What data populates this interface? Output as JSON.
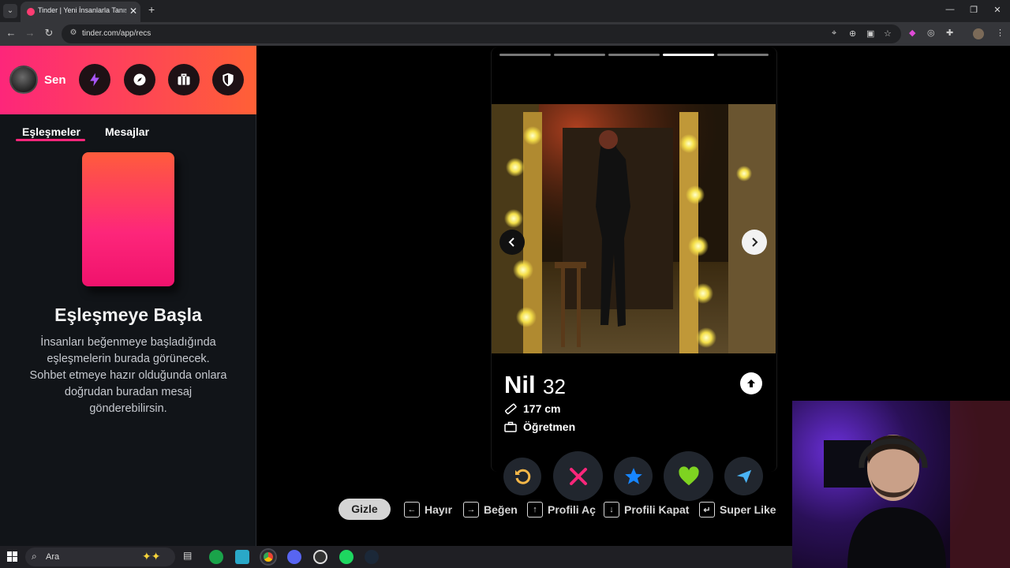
{
  "browser": {
    "tab_title": "Tinder | Yeni İnsanlarla Tanış, Bu",
    "url": "tinder.com/app/recs",
    "new_tab_symbol": "+",
    "close_symbol": "✕"
  },
  "sidebar": {
    "profile_name": "Sen",
    "header_buttons": [
      "lightning-icon",
      "compass-icon",
      "briefcase-icon",
      "shield-icon"
    ],
    "tabs": {
      "matches": "Eşleşmeler",
      "messages": "Mesajlar"
    },
    "empty_title": "Eşleşmeye Başla",
    "empty_desc": "İnsanları beğenmeye başladığında eşleşmelerin burada görünecek. Sohbet etmeye hazır olduğunda onlara doğrudan buradan mesaj gönderebilirsin."
  },
  "profile": {
    "name": "Nil",
    "age": "32",
    "height": "177 cm",
    "job": "Öğretmen",
    "photo_count": 5,
    "active_photo": 4
  },
  "actions": [
    "rewind",
    "nope",
    "super-like",
    "like",
    "boost"
  ],
  "shortcuts": {
    "hide": "Gizle",
    "items": [
      {
        "key": "←",
        "label": "Hayır"
      },
      {
        "key": "→",
        "label": "Beğen"
      },
      {
        "key": "↑",
        "label": "Profili Aç"
      },
      {
        "key": "↓",
        "label": "Profili Kapat"
      },
      {
        "key": "↵",
        "label": "Super Like"
      }
    ]
  },
  "taskbar": {
    "search_placeholder": "Ara"
  },
  "colors": {
    "brand_pink": "#fd267a",
    "brand_orange": "#ff6036",
    "nope": "#fd267a",
    "like": "#7ed321",
    "super": "#1786ff",
    "rewind": "#f5b748"
  }
}
